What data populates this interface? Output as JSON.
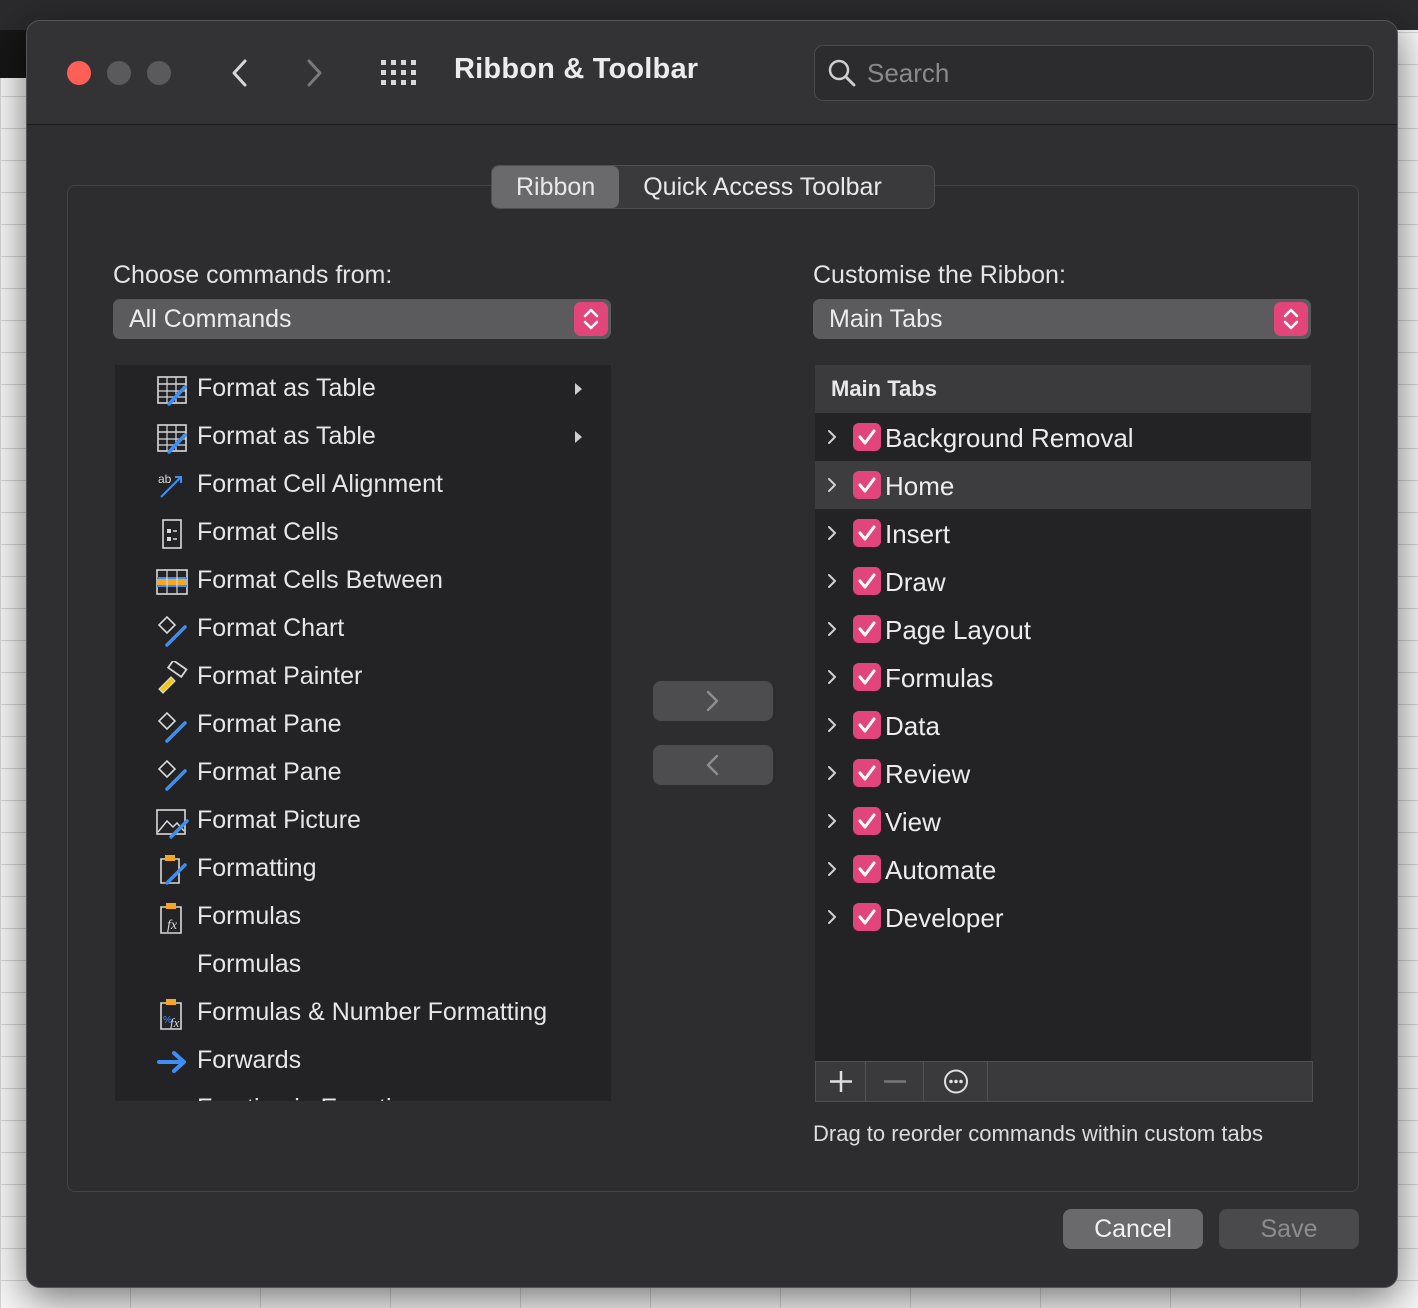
{
  "window": {
    "title": "Ribbon & Toolbar",
    "search_placeholder": "Search"
  },
  "segments": [
    {
      "label": "Ribbon",
      "active": true
    },
    {
      "label": "Quick Access Toolbar",
      "active": false
    }
  ],
  "left": {
    "label": "Choose commands from:",
    "dropdown_value": "All Commands",
    "commands": [
      {
        "label": "Format as Table",
        "icon": "format-table-icon",
        "submenu": true
      },
      {
        "label": "Format as Table",
        "icon": "format-table-icon",
        "submenu": true
      },
      {
        "label": "Format Cell Alignment",
        "icon": "cell-alignment-icon",
        "submenu": false
      },
      {
        "label": "Format Cells",
        "icon": "format-cells-icon",
        "submenu": false
      },
      {
        "label": "Format Cells Between",
        "icon": "cells-between-icon",
        "submenu": false
      },
      {
        "label": "Format Chart",
        "icon": "format-chart-icon",
        "submenu": false
      },
      {
        "label": "Format Painter",
        "icon": "format-painter-icon",
        "submenu": false
      },
      {
        "label": "Format Pane",
        "icon": "format-pane-icon",
        "submenu": false
      },
      {
        "label": "Format Pane",
        "icon": "format-pane-icon",
        "submenu": false
      },
      {
        "label": "Format Picture",
        "icon": "format-picture-icon",
        "submenu": false
      },
      {
        "label": "Formatting",
        "icon": "formatting-icon",
        "submenu": false
      },
      {
        "label": "Formulas",
        "icon": "formulas-icon",
        "submenu": false
      },
      {
        "label": "Formulas",
        "icon": "",
        "submenu": false
      },
      {
        "label": "Formulas & Number Formatting",
        "icon": "formulas-number-icon",
        "submenu": false
      },
      {
        "label": "Forwards",
        "icon": "forward-arrow-icon",
        "submenu": false
      },
      {
        "label": "Fraction in Equation",
        "icon": "fraction-icon",
        "submenu": true
      }
    ]
  },
  "right": {
    "label": "Customise the Ribbon:",
    "dropdown_value": "Main Tabs",
    "list_header": "Main Tabs",
    "tabs": [
      {
        "label": "Background Removal",
        "checked": true,
        "selected": false
      },
      {
        "label": "Home",
        "checked": true,
        "selected": true
      },
      {
        "label": "Insert",
        "checked": true,
        "selected": false
      },
      {
        "label": "Draw",
        "checked": true,
        "selected": false
      },
      {
        "label": "Page Layout",
        "checked": true,
        "selected": false
      },
      {
        "label": "Formulas",
        "checked": true,
        "selected": false
      },
      {
        "label": "Data",
        "checked": true,
        "selected": false
      },
      {
        "label": "Review",
        "checked": true,
        "selected": false
      },
      {
        "label": "View",
        "checked": true,
        "selected": false
      },
      {
        "label": "Automate",
        "checked": true,
        "selected": false
      },
      {
        "label": "Developer",
        "checked": true,
        "selected": false
      }
    ],
    "hint": "Drag to reorder commands within custom tabs"
  },
  "footer": {
    "cancel_label": "Cancel",
    "save_label": "Save"
  },
  "colors": {
    "accent": "#e2457a",
    "close": "#ff5f57"
  }
}
